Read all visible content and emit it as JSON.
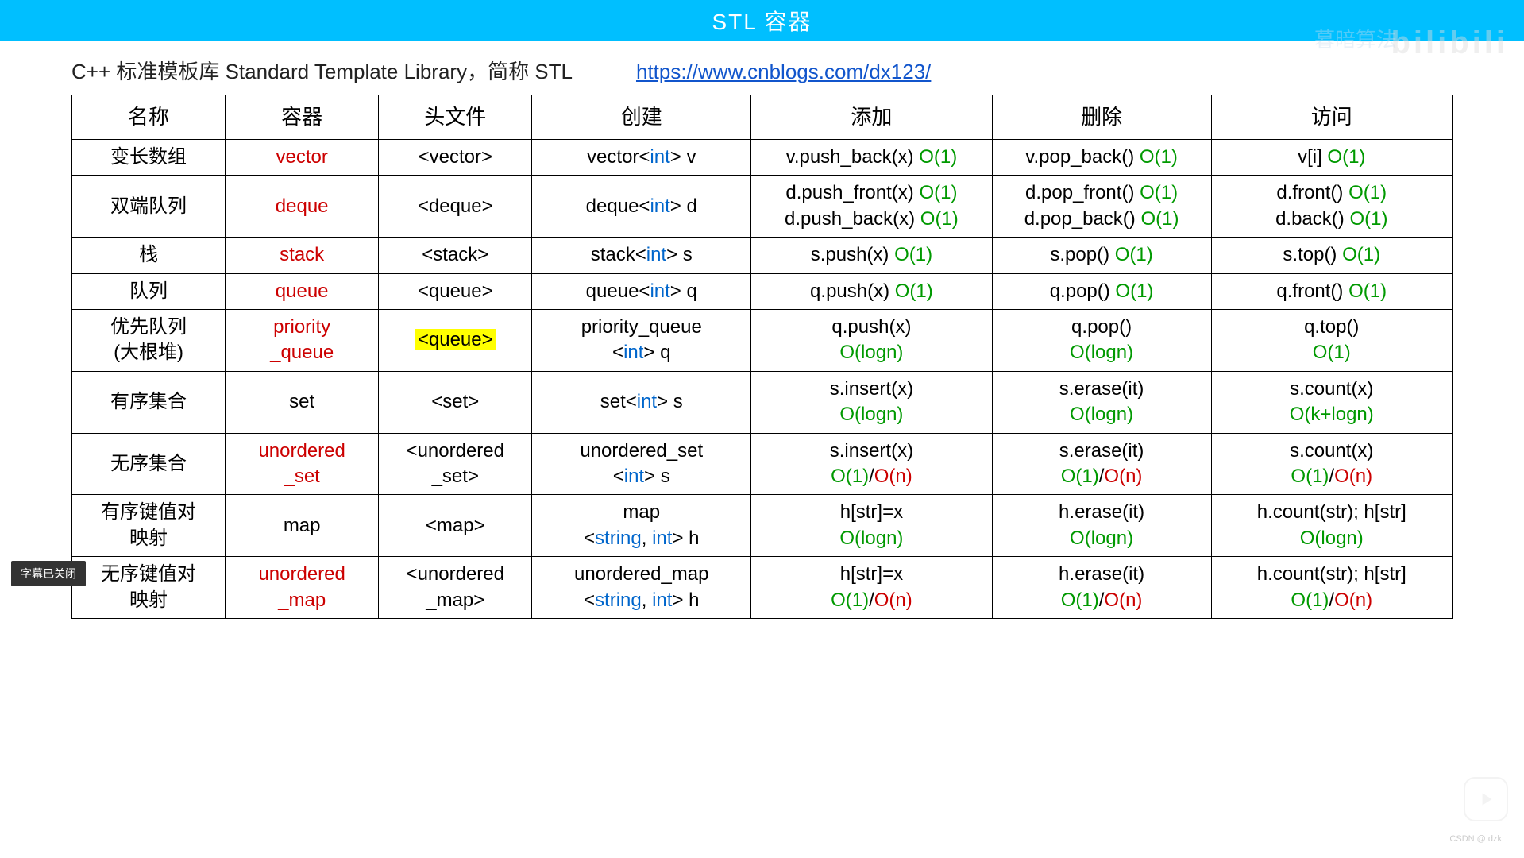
{
  "banner": {
    "title": "STL 容器"
  },
  "subtitle": {
    "text": "C++ 标准模板库 Standard Template Library，简称 STL",
    "link": "https://www.cnblogs.com/dx123/"
  },
  "table": {
    "headers": [
      "名称",
      "容器",
      "头文件",
      "创建",
      "添加",
      "删除",
      "访问"
    ],
    "rows": [
      {
        "name": "变长数组",
        "container": "vector",
        "header_file": [
          {
            "t": "<vector>"
          }
        ],
        "create": [
          {
            "t": "vector<"
          },
          {
            "t": "int",
            "c": "blue"
          },
          {
            "t": "> v"
          }
        ],
        "add": [
          {
            "t": "v.push_back(x) "
          },
          {
            "t": "O(1)",
            "c": "green"
          }
        ],
        "del": [
          {
            "t": "v.pop_back() "
          },
          {
            "t": "O(1)",
            "c": "green"
          }
        ],
        "access": [
          {
            "t": "v[i] "
          },
          {
            "t": "O(1)",
            "c": "green"
          }
        ]
      },
      {
        "name": "双端队列",
        "container": "deque",
        "header_file": [
          {
            "t": "<deque>"
          }
        ],
        "create": [
          {
            "t": "deque<"
          },
          {
            "t": "int",
            "c": "blue"
          },
          {
            "t": "> d"
          }
        ],
        "add": [
          {
            "t": "d.push_front(x) "
          },
          {
            "t": "O(1)",
            "c": "green"
          },
          {
            "br": true
          },
          {
            "t": "d.push_back(x) "
          },
          {
            "t": "O(1)",
            "c": "green"
          }
        ],
        "del": [
          {
            "t": "d.pop_front() "
          },
          {
            "t": "O(1)",
            "c": "green"
          },
          {
            "br": true
          },
          {
            "t": "d.pop_back() "
          },
          {
            "t": "O(1)",
            "c": "green"
          }
        ],
        "access": [
          {
            "t": "d.front() "
          },
          {
            "t": "O(1)",
            "c": "green"
          },
          {
            "br": true
          },
          {
            "t": "d.back() "
          },
          {
            "t": "O(1)",
            "c": "green"
          }
        ]
      },
      {
        "name": "栈",
        "container": "stack",
        "header_file": [
          {
            "t": "<stack>"
          }
        ],
        "create": [
          {
            "t": "stack<"
          },
          {
            "t": "int",
            "c": "blue"
          },
          {
            "t": "> s"
          }
        ],
        "add": [
          {
            "t": "s.push(x) "
          },
          {
            "t": "O(1)",
            "c": "green"
          }
        ],
        "del": [
          {
            "t": "s.pop() "
          },
          {
            "t": "O(1)",
            "c": "green"
          }
        ],
        "access": [
          {
            "t": "s.top() "
          },
          {
            "t": "O(1)",
            "c": "green"
          }
        ]
      },
      {
        "name": "队列",
        "container": "queue",
        "header_file": [
          {
            "t": "<queue>"
          }
        ],
        "create": [
          {
            "t": "queue<"
          },
          {
            "t": "int",
            "c": "blue"
          },
          {
            "t": "> q"
          }
        ],
        "add": [
          {
            "t": "q.push(x) "
          },
          {
            "t": "O(1)",
            "c": "green"
          }
        ],
        "del": [
          {
            "t": "q.pop() "
          },
          {
            "t": "O(1)",
            "c": "green"
          }
        ],
        "access": [
          {
            "t": "q.front() "
          },
          {
            "t": "O(1)",
            "c": "green"
          }
        ]
      },
      {
        "name": "优先队列\n(大根堆)",
        "container": "priority\n_queue",
        "header_file": [
          {
            "t": "<queue>",
            "hl": true
          }
        ],
        "create": [
          {
            "t": "priority_queue"
          },
          {
            "br": true
          },
          {
            "t": "<"
          },
          {
            "t": "int",
            "c": "blue"
          },
          {
            "t": "> q"
          }
        ],
        "add": [
          {
            "t": "q.push(x)"
          },
          {
            "br": true
          },
          {
            "t": "O(logn)",
            "c": "green"
          }
        ],
        "del": [
          {
            "t": "q.pop()"
          },
          {
            "br": true
          },
          {
            "t": "O(logn)",
            "c": "green"
          }
        ],
        "access": [
          {
            "t": "q.top()"
          },
          {
            "br": true
          },
          {
            "t": "O(1)",
            "c": "green"
          }
        ]
      },
      {
        "name": "有序集合",
        "container_plain": "set",
        "header_file": [
          {
            "t": "<set>"
          }
        ],
        "create": [
          {
            "t": "set<"
          },
          {
            "t": "int",
            "c": "blue"
          },
          {
            "t": "> s"
          }
        ],
        "add": [
          {
            "t": "s.insert(x)"
          },
          {
            "br": true
          },
          {
            "t": "O(logn)",
            "c": "green"
          }
        ],
        "del": [
          {
            "t": "s.erase(it)"
          },
          {
            "br": true
          },
          {
            "t": "O(logn)",
            "c": "green"
          }
        ],
        "access": [
          {
            "t": "s.count(x)"
          },
          {
            "br": true
          },
          {
            "t": "O(k+logn)",
            "c": "green"
          }
        ]
      },
      {
        "name": "无序集合",
        "container": "unordered\n_set",
        "header_file": [
          {
            "t": "<unordered"
          },
          {
            "br": true
          },
          {
            "t": "_set>"
          }
        ],
        "create": [
          {
            "t": "unordered_set"
          },
          {
            "br": true
          },
          {
            "t": "<"
          },
          {
            "t": "int",
            "c": "blue"
          },
          {
            "t": "> s"
          }
        ],
        "add": [
          {
            "t": "s.insert(x)"
          },
          {
            "br": true
          },
          {
            "t": "O(1)",
            "c": "green"
          },
          {
            "t": "/"
          },
          {
            "t": "O(n)",
            "c": "red"
          }
        ],
        "del": [
          {
            "t": "s.erase(it)"
          },
          {
            "br": true
          },
          {
            "t": "O(1)",
            "c": "green"
          },
          {
            "t": "/"
          },
          {
            "t": "O(n)",
            "c": "red"
          }
        ],
        "access": [
          {
            "t": "s.count(x)"
          },
          {
            "br": true
          },
          {
            "t": "O(1)",
            "c": "green"
          },
          {
            "t": "/"
          },
          {
            "t": "O(n)",
            "c": "red"
          }
        ]
      },
      {
        "name": "有序键值对\n映射",
        "container_plain": "map",
        "header_file": [
          {
            "t": "<map>"
          }
        ],
        "create": [
          {
            "t": "map"
          },
          {
            "br": true
          },
          {
            "t": "<"
          },
          {
            "t": "string",
            "c": "blue"
          },
          {
            "t": ", "
          },
          {
            "t": "int",
            "c": "blue"
          },
          {
            "t": "> h"
          }
        ],
        "add": [
          {
            "t": "h[str]=x"
          },
          {
            "br": true
          },
          {
            "t": "O(logn)",
            "c": "green"
          }
        ],
        "del": [
          {
            "t": "h.erase(it)"
          },
          {
            "br": true
          },
          {
            "t": "O(logn)",
            "c": "green"
          }
        ],
        "access": [
          {
            "t": "h.count(str); h[str]"
          },
          {
            "br": true
          },
          {
            "t": "O(logn)",
            "c": "green"
          }
        ]
      },
      {
        "name": "无序键值对\n映射",
        "container": "unordered\n_map",
        "header_file": [
          {
            "t": "<unordered"
          },
          {
            "br": true
          },
          {
            "t": "_map>"
          }
        ],
        "create": [
          {
            "t": "unordered_map"
          },
          {
            "br": true
          },
          {
            "t": "<"
          },
          {
            "t": "string",
            "c": "blue"
          },
          {
            "t": ", "
          },
          {
            "t": "int",
            "c": "blue"
          },
          {
            "t": "> h"
          }
        ],
        "add": [
          {
            "t": "h[str]=x"
          },
          {
            "br": true
          },
          {
            "t": "O(1)",
            "c": "green"
          },
          {
            "t": "/"
          },
          {
            "t": "O(n)",
            "c": "red"
          }
        ],
        "del": [
          {
            "t": "h.erase(it)"
          },
          {
            "br": true
          },
          {
            "t": "O(1)",
            "c": "green"
          },
          {
            "t": "/"
          },
          {
            "t": "O(n)",
            "c": "red"
          }
        ],
        "access": [
          {
            "t": "h.count(str); h[str]"
          },
          {
            "br": true
          },
          {
            "t": "O(1)",
            "c": "green"
          },
          {
            "t": "/"
          },
          {
            "t": "O(n)",
            "c": "red"
          }
        ]
      }
    ]
  },
  "tooltip": "字幕已关闭",
  "watermark_bili": "bilibili",
  "watermark_name": "暮暗算法",
  "watermark_csdn": "CSDN @ dzk"
}
